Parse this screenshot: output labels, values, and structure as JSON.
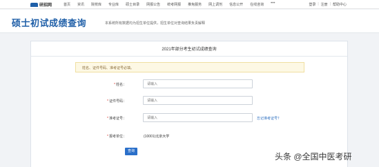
{
  "topbar": {
    "logo_text": "研招网",
    "nav": [
      "首页",
      "资讯",
      "院校库",
      "专业库",
      "硕士目录",
      "网报公告",
      "统考网报",
      "推免服务",
      "网上调剂",
      "信息公开",
      "在线咨询"
    ],
    "more": "•••",
    "account": {
      "login": "登录",
      "sep1": "|",
      "register": "注册",
      "sep2": "|",
      "help": "帮助中心"
    }
  },
  "header": {
    "title": "硕士初试成绩查询",
    "description": "本系统所有数据均为招生单位提供，招生单位对查询结果负责解释"
  },
  "panel": {
    "title": "2021年部分考生初试成绩查询",
    "notice": "姓名、证件号码、准考证号必填。"
  },
  "form": {
    "name": {
      "label": "姓名：",
      "placeholder": "请输入"
    },
    "id_number": {
      "label": "证件号码：",
      "placeholder": "请输入"
    },
    "exam_number": {
      "label": "准考证号：",
      "placeholder": "请输入"
    },
    "forgot_link": "忘记准考证号？",
    "institution": {
      "label": "报考单位：",
      "value": "(10001)北京大学"
    },
    "required_mark": "*",
    "submit_label": "查询"
  },
  "watermark": "头条 @全国中医考研"
}
